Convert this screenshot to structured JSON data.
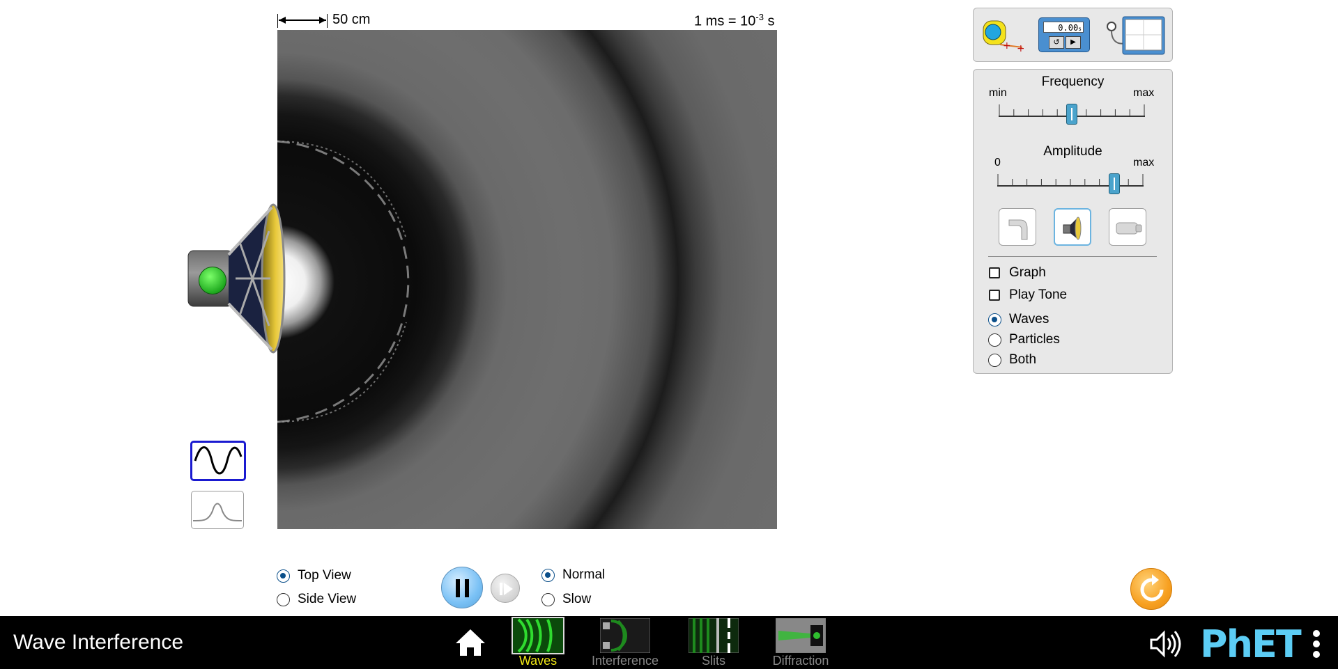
{
  "scale": {
    "length_label": "50 cm",
    "time_prefix": "1 ms = 10",
    "time_exp": "-3",
    "time_unit": " s"
  },
  "tools": {
    "stopwatch_value": "0.00",
    "stopwatch_unit": "s"
  },
  "frequency": {
    "title": "Frequency",
    "min_label": "min",
    "max_label": "max",
    "value_fraction": 0.5
  },
  "amplitude": {
    "title": "Amplitude",
    "min_label": "0",
    "max_label": "max",
    "value_fraction": 0.8
  },
  "sources": [
    {
      "name": "water-drip"
    },
    {
      "name": "speaker",
      "selected": true
    },
    {
      "name": "laser"
    }
  ],
  "checkboxes": [
    {
      "label": "Graph",
      "checked": false
    },
    {
      "label": "Play Tone",
      "checked": false
    }
  ],
  "view_modes": [
    {
      "label": "Waves",
      "selected": true
    },
    {
      "label": "Particles",
      "selected": false
    },
    {
      "label": "Both",
      "selected": false
    }
  ],
  "views": [
    {
      "label": "Top View",
      "selected": true
    },
    {
      "label": "Side View",
      "selected": false
    }
  ],
  "speeds": [
    {
      "label": "Normal",
      "selected": true
    },
    {
      "label": "Slow",
      "selected": false
    }
  ],
  "navbar": {
    "title": "Wave Interference",
    "tabs": [
      {
        "label": "Waves",
        "active": true
      },
      {
        "label": "Interference",
        "active": false
      },
      {
        "label": "Slits",
        "active": false
      },
      {
        "label": "Diffraction",
        "active": false
      }
    ],
    "brand": "PhET"
  },
  "colors": {
    "accent_blue": "#4aa3cc",
    "nav_active": "#f2e916",
    "reset_orange": "#f7a021",
    "phet_blue": "#5ccdf5"
  }
}
